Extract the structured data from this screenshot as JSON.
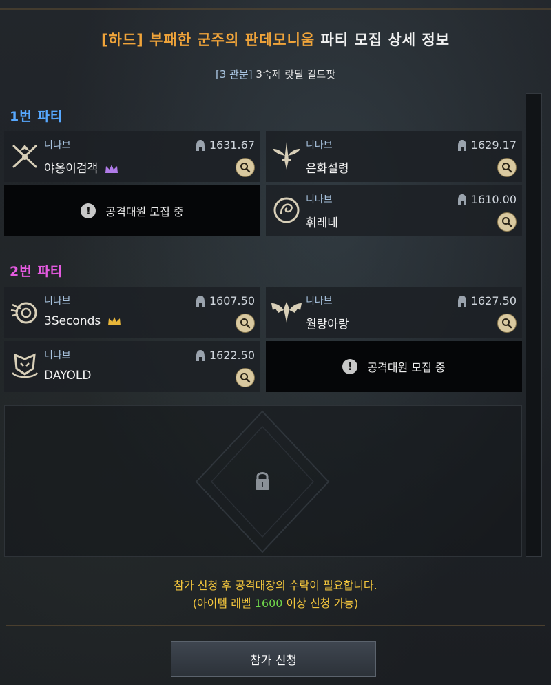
{
  "title": {
    "difficulty": "[하드]",
    "raid": " 부패한 군주의 판데모니움",
    "rest": " 파티 모집 상세 정보"
  },
  "subtitle": {
    "gate": "[3 관문]",
    "desc": " 3숙제 랏딜 길드팟"
  },
  "parties": [
    {
      "label": "1번 파티",
      "slots": [
        {
          "server": "니나브",
          "name": "야옹이검객",
          "ilvl": "1631.67",
          "leader": true,
          "leader_color": "#b07be8"
        },
        {
          "server": "니나브",
          "name": "은화설령",
          "ilvl": "1629.17",
          "leader": false
        },
        {
          "empty": true,
          "label": "공격대원 모집 중"
        },
        {
          "server": "니나브",
          "name": "휘레네",
          "ilvl": "1610.00",
          "leader": false
        }
      ]
    },
    {
      "label": "2번 파티",
      "slots": [
        {
          "server": "니나브",
          "name": "3Seconds",
          "ilvl": "1607.50",
          "leader": true,
          "leader_color": "#e8b63a"
        },
        {
          "server": "니나브",
          "name": "월랑아랑",
          "ilvl": "1627.50",
          "leader": false
        },
        {
          "server": "니나브",
          "name": "DAYOLD",
          "ilvl": "1622.50",
          "leader": false
        },
        {
          "empty": true,
          "label": "공격대원 모집 중"
        }
      ]
    }
  ],
  "notice": {
    "line1": "참가 신청 후 공격대장의 수락이 필요합니다.",
    "line2_prefix": "(아이템 레벨 ",
    "line2_level": "1600",
    "line2_suffix": " 이상 신청 가능)"
  },
  "join_button": "참가 신청",
  "colors": {
    "party1": "#57a8ff",
    "party2": "#e45ae0",
    "difficulty": "#f0a43a",
    "notice": "#f2c53d",
    "level": "#6fd44a"
  }
}
